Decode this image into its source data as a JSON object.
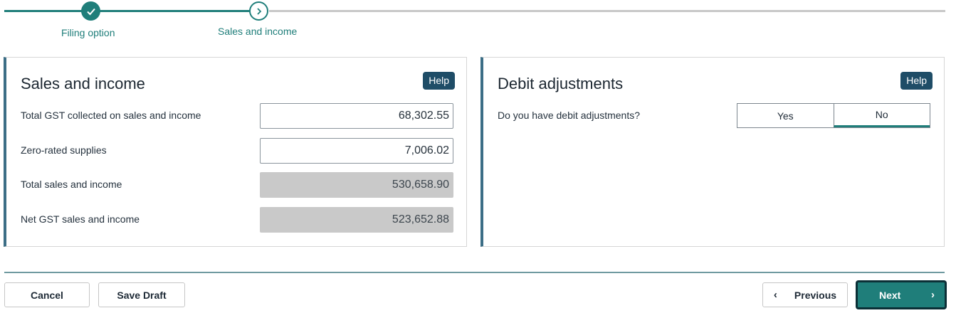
{
  "stepper": {
    "steps": [
      {
        "label": "Filing option",
        "state": "completed"
      },
      {
        "label": "Sales and income",
        "state": "current"
      }
    ],
    "current_icon": "chevron-right-icon",
    "completed_icon": "check-icon"
  },
  "sales_panel": {
    "title": "Sales and income",
    "help_label": "Help",
    "fields": [
      {
        "label": "Total GST collected on sales and income",
        "value": "68,302.55",
        "editable": true
      },
      {
        "label": "Zero-rated supplies",
        "value": "7,006.02",
        "editable": true
      },
      {
        "label": "Total sales and income",
        "value": "530,658.90",
        "editable": false
      },
      {
        "label": "Net GST sales and income",
        "value": "523,652.88",
        "editable": false
      }
    ]
  },
  "debit_panel": {
    "title": "Debit adjustments",
    "help_label": "Help",
    "question": "Do you have debit adjustments?",
    "options": [
      "Yes",
      "No"
    ],
    "selected": "No"
  },
  "footer": {
    "cancel_label": "Cancel",
    "save_draft_label": "Save Draft",
    "previous_label": "Previous",
    "next_label": "Next"
  },
  "colors": {
    "accent": "#1f7e7a",
    "help_button": "#1f4d67",
    "panel_border": "#3c6e86",
    "readonly_field": "#c9c9c9"
  }
}
